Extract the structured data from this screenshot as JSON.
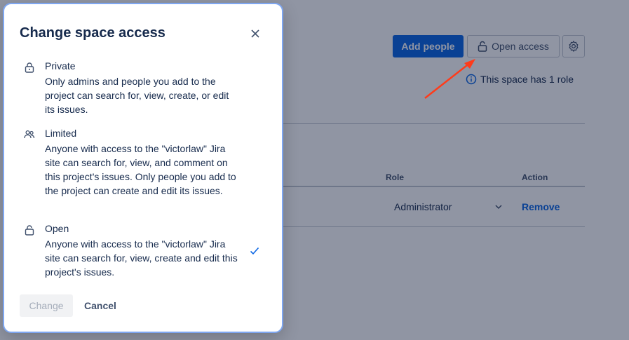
{
  "background": {
    "add_people_label": "Add people",
    "open_access_label": "Open access",
    "role_info": "This space has 1 role",
    "table": {
      "headers": [
        "Role",
        "Action"
      ],
      "row": {
        "role": "Administrator",
        "action": "Remove"
      }
    }
  },
  "modal": {
    "title": "Change space access",
    "options": [
      {
        "name": "Private",
        "description": "Only admins and people you add to the project can search for, view, create, or edit its issues.",
        "icon": "lock-icon"
      },
      {
        "name": "Limited",
        "description": "Anyone with access to the \"victorlaw\" Jira site can search for, view, and comment on this project's issues. Only people you add to the project can create and edit its issues.",
        "icon": "people-icon"
      },
      {
        "name": "Open",
        "description": "Anyone with access to the \"victorlaw\" Jira site can search for, view, create and edit this project's issues.",
        "icon": "unlock-icon",
        "selected": true
      }
    ],
    "change_label": "Change",
    "cancel_label": "Cancel"
  },
  "colors": {
    "primary": "#0c66e4",
    "annotation_arrow": "#ff3b1a"
  }
}
